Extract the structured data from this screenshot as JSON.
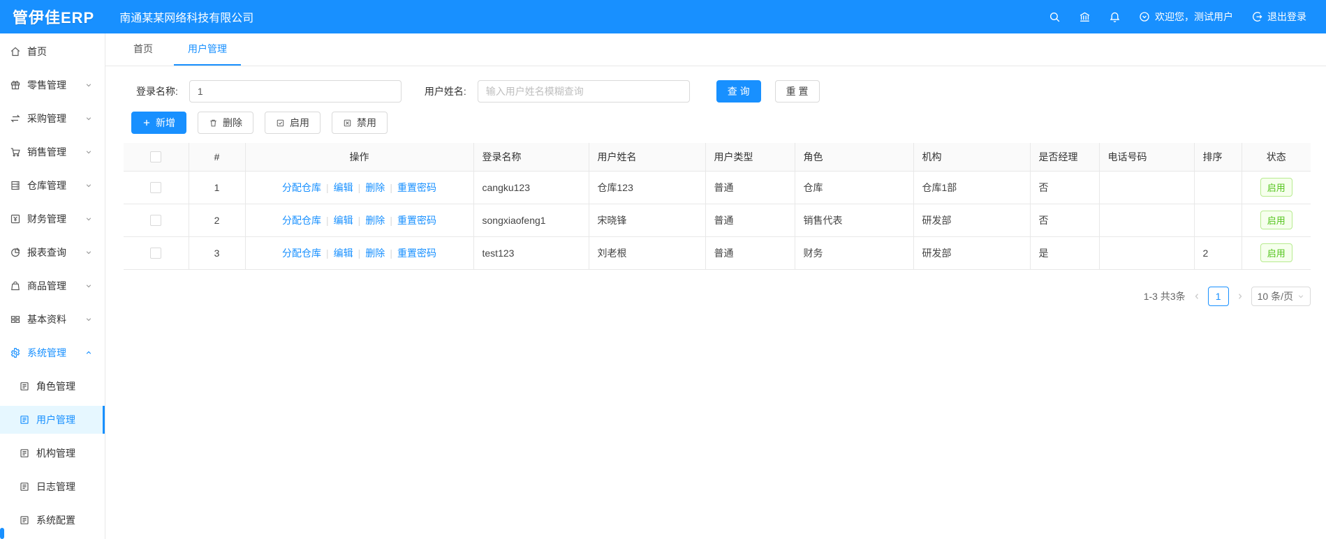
{
  "colors": {
    "accent": "#1890ff",
    "status_green": "#52c41a",
    "status_green_bg": "#f6ffed",
    "status_green_border": "#b7eb8f"
  },
  "header": {
    "logo": "管伊佳ERP",
    "company": "南通某某网络科技有限公司",
    "welcome": "欢迎您，测试用户",
    "logout_label": "退出登录"
  },
  "tabs": {
    "home": "首页",
    "current": "用户管理"
  },
  "sidebar": {
    "items": [
      {
        "label": "首页"
      },
      {
        "label": "零售管理"
      },
      {
        "label": "采购管理"
      },
      {
        "label": "销售管理"
      },
      {
        "label": "仓库管理"
      },
      {
        "label": "财务管理"
      },
      {
        "label": "报表查询"
      },
      {
        "label": "商品管理"
      },
      {
        "label": "基本资料"
      },
      {
        "label": "系统管理"
      }
    ],
    "submenu": [
      {
        "label": "角色管理"
      },
      {
        "label": "用户管理"
      },
      {
        "label": "机构管理"
      },
      {
        "label": "日志管理"
      },
      {
        "label": "系统配置"
      }
    ]
  },
  "search": {
    "login_label": "登录名称:",
    "login_value": "1",
    "name_label": "用户姓名:",
    "name_placeholder": "输入用户姓名模糊查询",
    "search_label": "查 询",
    "reset_label": "重 置"
  },
  "toolbar": {
    "add": "新增",
    "delete": "删除",
    "enable": "启用",
    "disable": "禁用"
  },
  "table": {
    "columns": [
      "#",
      "操作",
      "登录名称",
      "用户姓名",
      "用户类型",
      "角色",
      "机构",
      "是否经理",
      "电话号码",
      "排序",
      "状态"
    ],
    "op_labels": {
      "assign": "分配仓库",
      "edit": "编辑",
      "delete": "删除",
      "reset_pwd": "重置密码"
    },
    "op_separator": "|",
    "rows": [
      {
        "index": "1",
        "login": "cangku123",
        "name": "仓库123",
        "type": "普通",
        "role": "仓库",
        "org": "仓库1部",
        "manager": "否",
        "phone": "",
        "sort": "",
        "status": "启用"
      },
      {
        "index": "2",
        "login": "songxiaofeng1",
        "name": "宋晓锋",
        "type": "普通",
        "role": "销售代表",
        "org": "研发部",
        "manager": "否",
        "phone": "",
        "sort": "",
        "status": "启用"
      },
      {
        "index": "3",
        "login": "test123",
        "name": "刘老根",
        "type": "普通",
        "role": "财务",
        "org": "研发部",
        "manager": "是",
        "phone": "",
        "sort": "2",
        "status": "启用"
      }
    ]
  },
  "pagination": {
    "total": "1-3 共3条",
    "page": "1",
    "page_size": "10 条/页"
  }
}
